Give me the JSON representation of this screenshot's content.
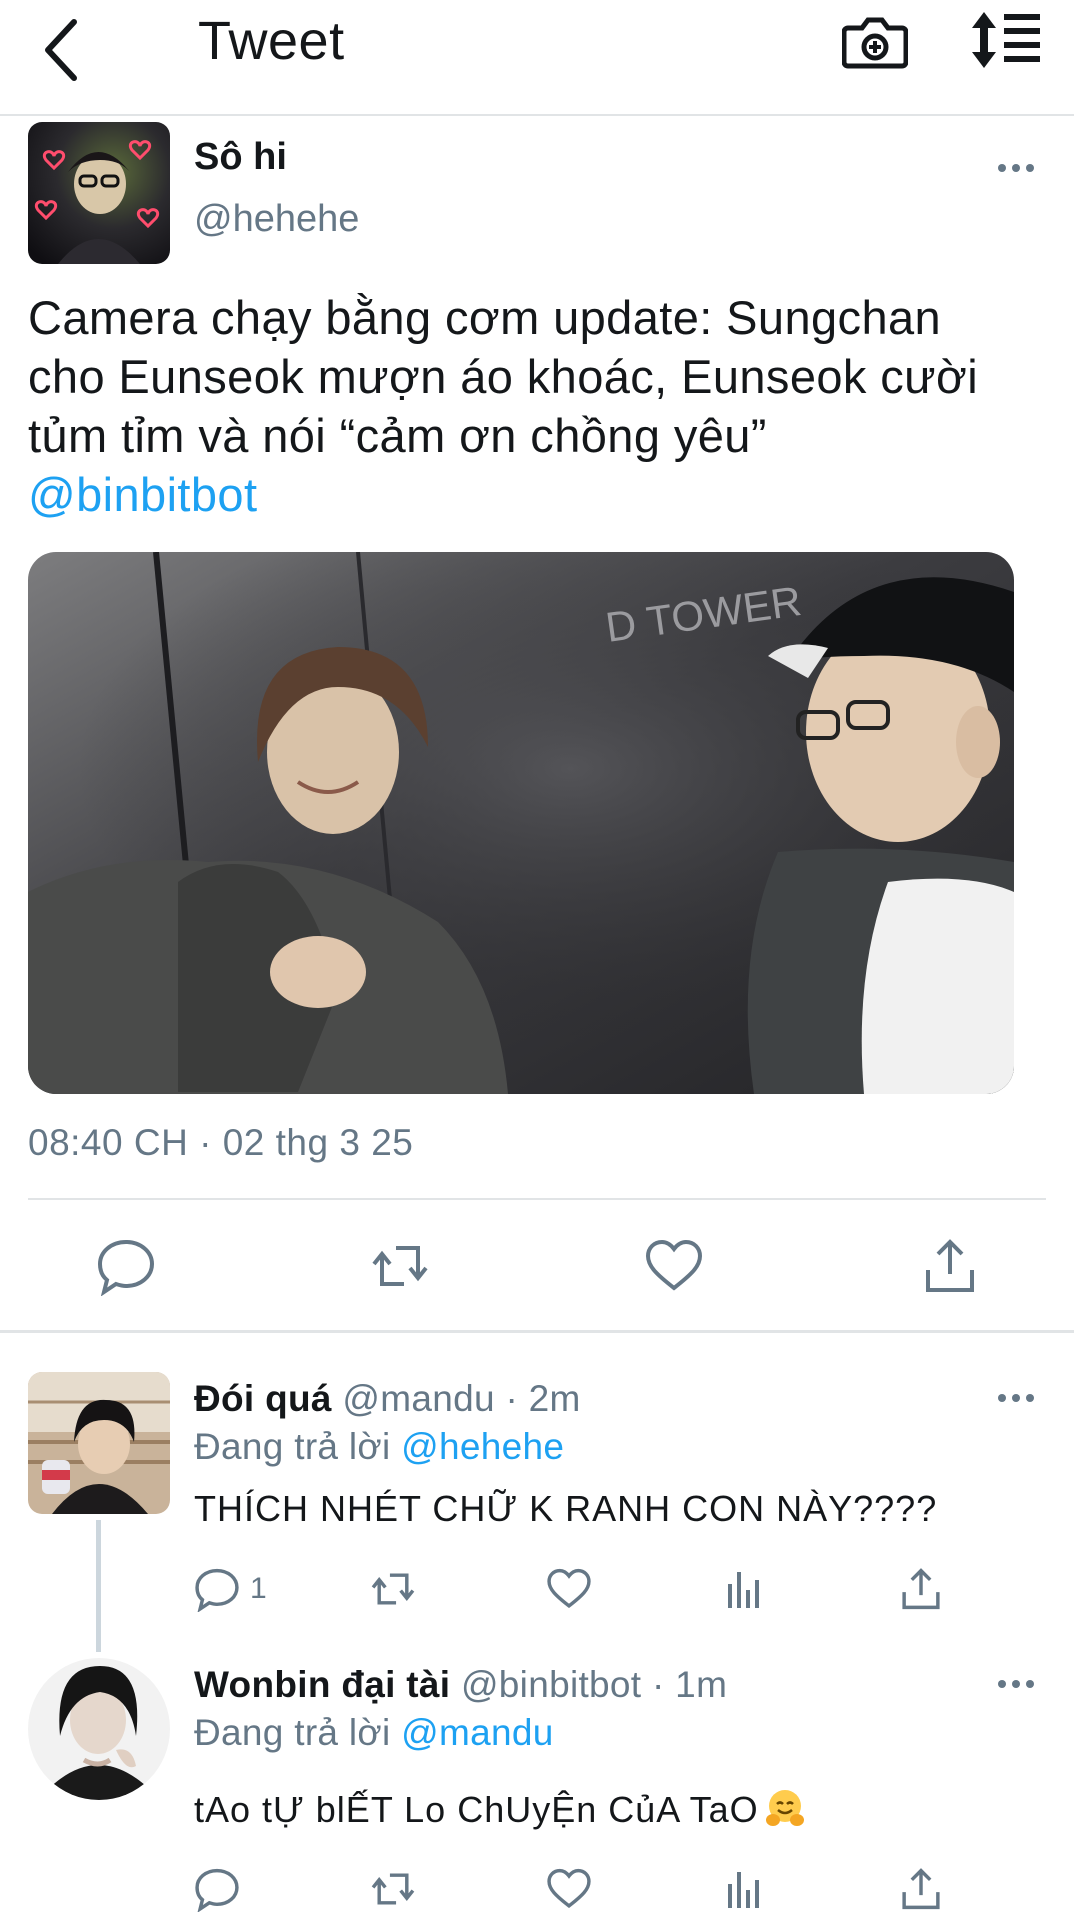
{
  "header": {
    "title": "Tweet"
  },
  "tweet": {
    "author_name": "Sô hi",
    "author_handle": "@hehehe",
    "text_line1": "Camera chạy bằng cơm update: Sungchan",
    "text_line2": "cho Eunseok mượn áo khoác, Eunseok cười",
    "text_line3": "tủm tỉm và nói “cảm ơn chồng yêu”",
    "mention": "@binbitbot",
    "image_watermark": "D TOWER",
    "timestamp": "08:40 CH · 02 thg 3 25",
    "actions": [
      "reply-icon",
      "retweet-icon",
      "like-icon",
      "share-icon"
    ]
  },
  "replies": [
    {
      "name": "Đói quá",
      "handle": "@mandu",
      "time": "· 2m",
      "replying_label": "Đang trả lời",
      "replying_to": "@hehehe",
      "text": "THÍCH NHÉT CHỮ K RANH CON NÀY????",
      "reply_count": "1"
    },
    {
      "name": "Wonbin đại tài",
      "handle": "@binbitbot",
      "time": "· 1m",
      "replying_label": "Đang trả lời",
      "replying_to": "@mandu",
      "text": "tAo tỰ blẾT Lo ChUyỆn CủA TaO",
      "emoji": "hugging-face-emoji"
    }
  ],
  "colors": {
    "accent": "#1da1f2",
    "secondary_text": "#657786",
    "primary_text": "#14171a",
    "divider": "#e1e4e6"
  }
}
